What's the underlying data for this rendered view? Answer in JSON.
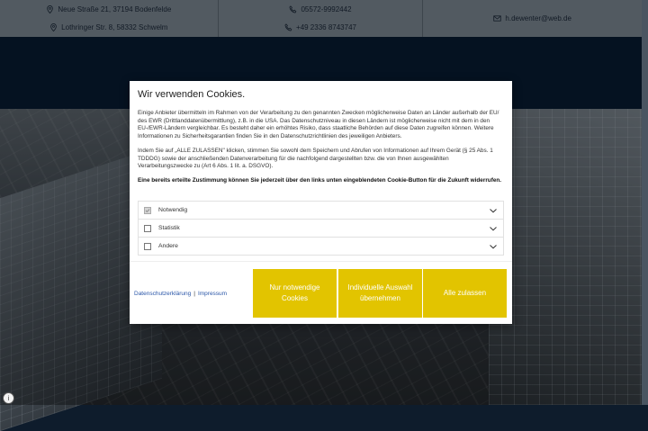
{
  "contact_bar": {
    "addresses": [
      "Neue Straße 21, 37194 Bodenfelde",
      "Lothringer Str. 8, 58332 Schwelm"
    ],
    "phones": [
      "05572-9992442",
      "+49 2336 8743747"
    ],
    "email": "h.dewenter@web.de"
  },
  "cookie_modal": {
    "title": "Wir verwenden Cookies.",
    "paragraph1": "Einige Anbieter übermitteln im Rahmen von der Verarbeitung zu den genannten Zwecken möglicherweise Daten an Länder außerhalb der EU/ des EWR (Drittlanddatenübermittlung), z.B. in die USA. Das Datenschutzniveau in diesen Ländern ist möglicherweise nicht mit dem in den EU-/EWR-Ländern vergleichbar. Es besteht daher ein erhöhtes Risiko, dass staatliche Behörden auf diese Daten zugreifen können. Weitere Informationen zu Sicherheitsgarantien finden Sie in den Datenschutzrichtlinien des jeweiligen Anbieters.",
    "paragraph2": "Indem Sie auf „ALLE ZULASSEN\" klicken, stimmen Sie sowohl dem Speichern und Abrufen von Informationen auf Ihrem Gerät (§ 25 Abs. 1 TDDDG) sowie der anschließenden Datenverarbeitung für die nachfolgend dargestellten bzw. die von Ihnen ausgewählten Verarbeitungszwecke zu (Art 6 Abs. 1 lit. a. DSGVO).",
    "paragraph3": "Eine bereits erteilte Zustimmung können Sie jederzeit über den links unten eingeblendeten Cookie-Button für die Zukunft widerrufen.",
    "options": [
      {
        "label": "Notwendig",
        "checked": true,
        "disabled": true
      },
      {
        "label": "Statistik",
        "checked": false,
        "disabled": false
      },
      {
        "label": "Andere",
        "checked": false,
        "disabled": false
      }
    ],
    "links": {
      "privacy": "Datenschutzerklärung",
      "separator": "|",
      "imprint": "Impressum"
    },
    "buttons": {
      "necessary": "Nur notwendige Cookies",
      "custom": "Individuelle Auswahl übernehmen",
      "all": "Alle zulassen"
    }
  },
  "colors": {
    "accent": "#e2c400",
    "band": "#081c33",
    "topbar": "#7e8a96"
  },
  "privacy_fab_icon": "info-icon"
}
